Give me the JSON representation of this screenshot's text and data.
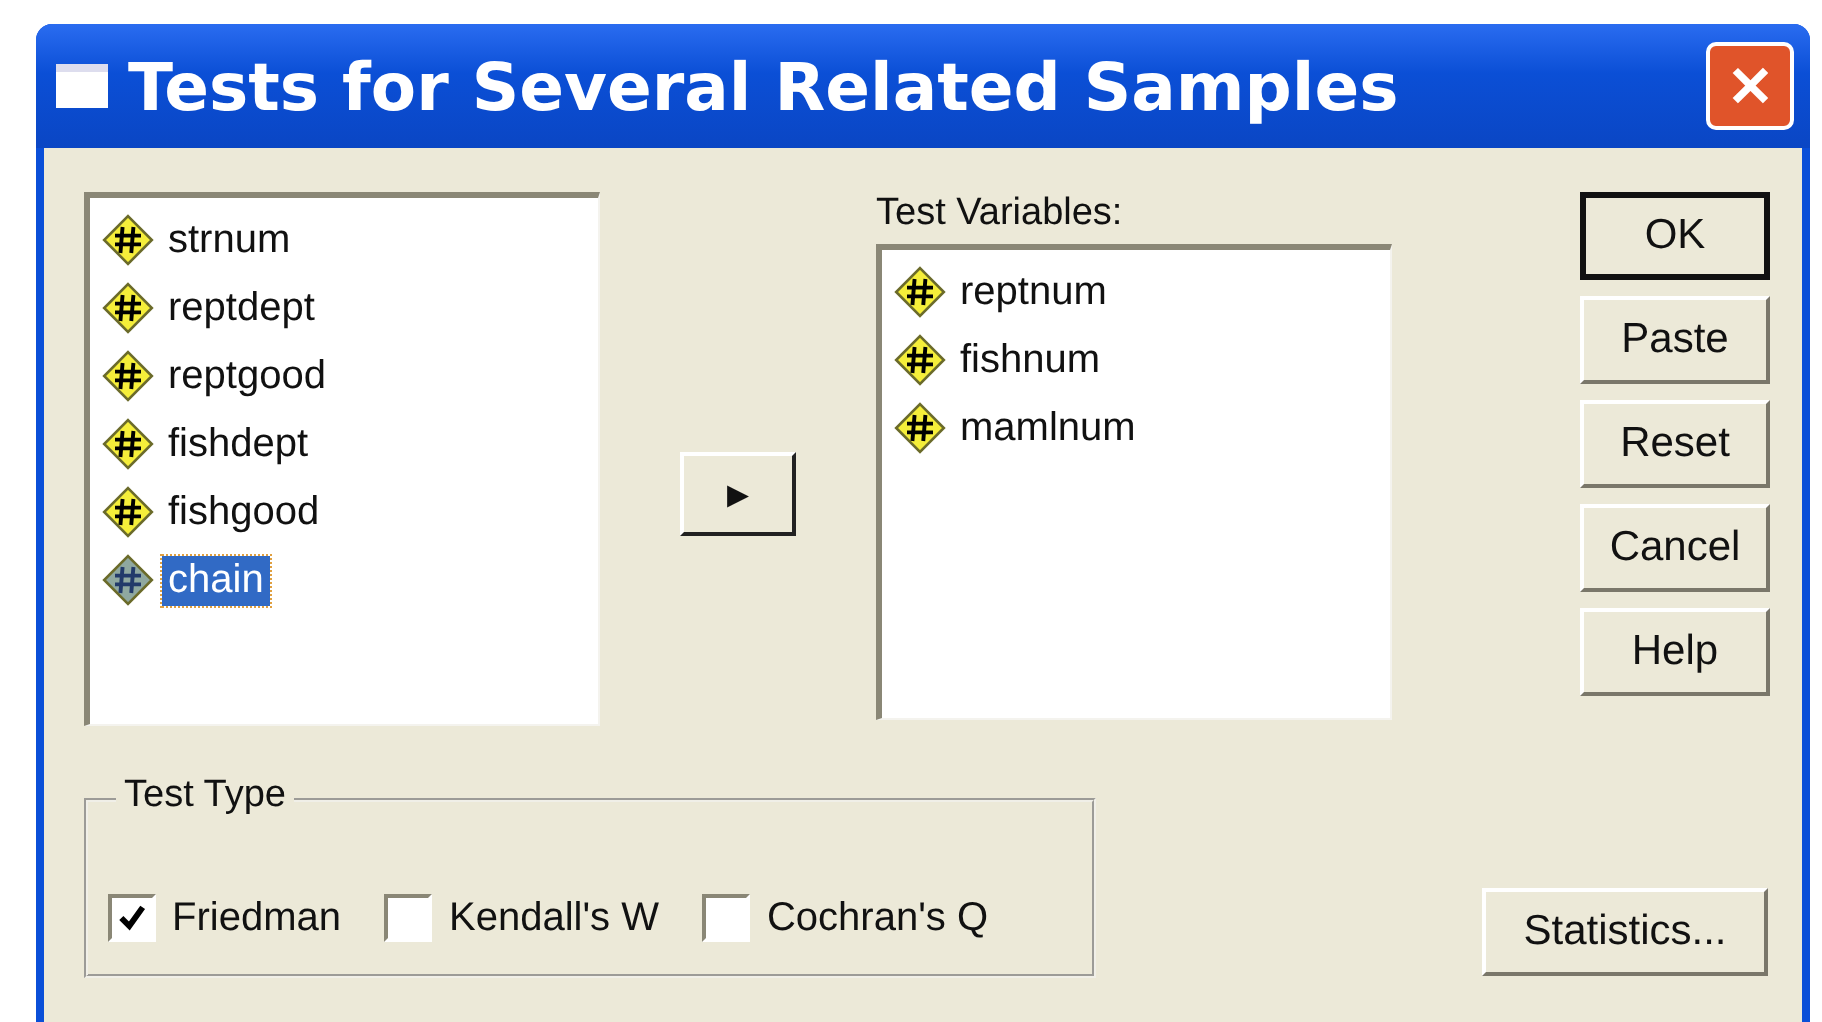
{
  "window": {
    "title": "Tests for Several Related Samples",
    "close": "✕"
  },
  "source_list": {
    "items": [
      {
        "name": "strnum",
        "selected": false
      },
      {
        "name": "reptdept",
        "selected": false
      },
      {
        "name": "reptgood",
        "selected": false
      },
      {
        "name": "fishdept",
        "selected": false
      },
      {
        "name": "fishgood",
        "selected": false
      },
      {
        "name": "chain",
        "selected": true
      }
    ]
  },
  "move_button": "▸",
  "test_variables": {
    "label": "Test Variables:",
    "items": [
      {
        "name": "reptnum",
        "selected": false
      },
      {
        "name": "fishnum",
        "selected": false
      },
      {
        "name": "mamlnum",
        "selected": false
      }
    ]
  },
  "buttons": [
    {
      "label": "OK",
      "default": true
    },
    {
      "label": "Paste",
      "default": false
    },
    {
      "label": "Reset",
      "default": false
    },
    {
      "label": "Cancel",
      "default": false
    },
    {
      "label": "Help",
      "default": false
    }
  ],
  "test_type": {
    "title": "Test Type",
    "options": [
      {
        "label": "Friedman",
        "checked": true
      },
      {
        "label": "Kendall's W",
        "checked": false
      },
      {
        "label": "Cochran's Q",
        "checked": false
      }
    ]
  },
  "statistics_button": "Statistics..."
}
